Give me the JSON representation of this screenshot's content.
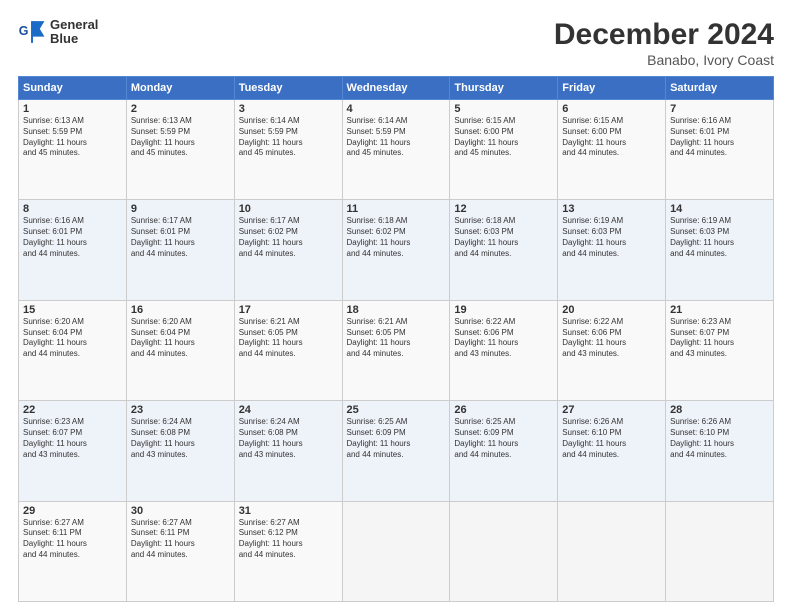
{
  "header": {
    "logo_line1": "General",
    "logo_line2": "Blue",
    "main_title": "December 2024",
    "subtitle": "Banabo, Ivory Coast"
  },
  "days_of_week": [
    "Sunday",
    "Monday",
    "Tuesday",
    "Wednesday",
    "Thursday",
    "Friday",
    "Saturday"
  ],
  "weeks": [
    [
      {
        "day": "1",
        "info": "Sunrise: 6:13 AM\nSunset: 5:59 PM\nDaylight: 11 hours\nand 45 minutes."
      },
      {
        "day": "2",
        "info": "Sunrise: 6:13 AM\nSunset: 5:59 PM\nDaylight: 11 hours\nand 45 minutes."
      },
      {
        "day": "3",
        "info": "Sunrise: 6:14 AM\nSunset: 5:59 PM\nDaylight: 11 hours\nand 45 minutes."
      },
      {
        "day": "4",
        "info": "Sunrise: 6:14 AM\nSunset: 5:59 PM\nDaylight: 11 hours\nand 45 minutes."
      },
      {
        "day": "5",
        "info": "Sunrise: 6:15 AM\nSunset: 6:00 PM\nDaylight: 11 hours\nand 45 minutes."
      },
      {
        "day": "6",
        "info": "Sunrise: 6:15 AM\nSunset: 6:00 PM\nDaylight: 11 hours\nand 44 minutes."
      },
      {
        "day": "7",
        "info": "Sunrise: 6:16 AM\nSunset: 6:01 PM\nDaylight: 11 hours\nand 44 minutes."
      }
    ],
    [
      {
        "day": "8",
        "info": "Sunrise: 6:16 AM\nSunset: 6:01 PM\nDaylight: 11 hours\nand 44 minutes."
      },
      {
        "day": "9",
        "info": "Sunrise: 6:17 AM\nSunset: 6:01 PM\nDaylight: 11 hours\nand 44 minutes."
      },
      {
        "day": "10",
        "info": "Sunrise: 6:17 AM\nSunset: 6:02 PM\nDaylight: 11 hours\nand 44 minutes."
      },
      {
        "day": "11",
        "info": "Sunrise: 6:18 AM\nSunset: 6:02 PM\nDaylight: 11 hours\nand 44 minutes."
      },
      {
        "day": "12",
        "info": "Sunrise: 6:18 AM\nSunset: 6:03 PM\nDaylight: 11 hours\nand 44 minutes."
      },
      {
        "day": "13",
        "info": "Sunrise: 6:19 AM\nSunset: 6:03 PM\nDaylight: 11 hours\nand 44 minutes."
      },
      {
        "day": "14",
        "info": "Sunrise: 6:19 AM\nSunset: 6:03 PM\nDaylight: 11 hours\nand 44 minutes."
      }
    ],
    [
      {
        "day": "15",
        "info": "Sunrise: 6:20 AM\nSunset: 6:04 PM\nDaylight: 11 hours\nand 44 minutes."
      },
      {
        "day": "16",
        "info": "Sunrise: 6:20 AM\nSunset: 6:04 PM\nDaylight: 11 hours\nand 44 minutes."
      },
      {
        "day": "17",
        "info": "Sunrise: 6:21 AM\nSunset: 6:05 PM\nDaylight: 11 hours\nand 44 minutes."
      },
      {
        "day": "18",
        "info": "Sunrise: 6:21 AM\nSunset: 6:05 PM\nDaylight: 11 hours\nand 44 minutes."
      },
      {
        "day": "19",
        "info": "Sunrise: 6:22 AM\nSunset: 6:06 PM\nDaylight: 11 hours\nand 43 minutes."
      },
      {
        "day": "20",
        "info": "Sunrise: 6:22 AM\nSunset: 6:06 PM\nDaylight: 11 hours\nand 43 minutes."
      },
      {
        "day": "21",
        "info": "Sunrise: 6:23 AM\nSunset: 6:07 PM\nDaylight: 11 hours\nand 43 minutes."
      }
    ],
    [
      {
        "day": "22",
        "info": "Sunrise: 6:23 AM\nSunset: 6:07 PM\nDaylight: 11 hours\nand 43 minutes."
      },
      {
        "day": "23",
        "info": "Sunrise: 6:24 AM\nSunset: 6:08 PM\nDaylight: 11 hours\nand 43 minutes."
      },
      {
        "day": "24",
        "info": "Sunrise: 6:24 AM\nSunset: 6:08 PM\nDaylight: 11 hours\nand 43 minutes."
      },
      {
        "day": "25",
        "info": "Sunrise: 6:25 AM\nSunset: 6:09 PM\nDaylight: 11 hours\nand 44 minutes."
      },
      {
        "day": "26",
        "info": "Sunrise: 6:25 AM\nSunset: 6:09 PM\nDaylight: 11 hours\nand 44 minutes."
      },
      {
        "day": "27",
        "info": "Sunrise: 6:26 AM\nSunset: 6:10 PM\nDaylight: 11 hours\nand 44 minutes."
      },
      {
        "day": "28",
        "info": "Sunrise: 6:26 AM\nSunset: 6:10 PM\nDaylight: 11 hours\nand 44 minutes."
      }
    ],
    [
      {
        "day": "29",
        "info": "Sunrise: 6:27 AM\nSunset: 6:11 PM\nDaylight: 11 hours\nand 44 minutes."
      },
      {
        "day": "30",
        "info": "Sunrise: 6:27 AM\nSunset: 6:11 PM\nDaylight: 11 hours\nand 44 minutes."
      },
      {
        "day": "31",
        "info": "Sunrise: 6:27 AM\nSunset: 6:12 PM\nDaylight: 11 hours\nand 44 minutes."
      },
      {
        "day": "",
        "info": ""
      },
      {
        "day": "",
        "info": ""
      },
      {
        "day": "",
        "info": ""
      },
      {
        "day": "",
        "info": ""
      }
    ]
  ]
}
